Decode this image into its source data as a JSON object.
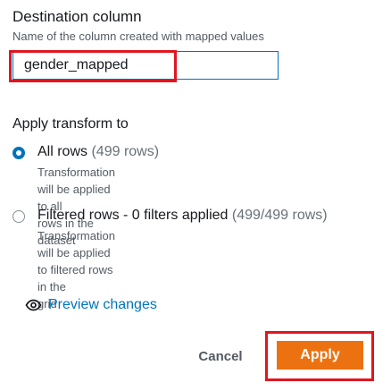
{
  "destination": {
    "title": "Destination column",
    "subtitle": "Name of the column created with mapped values",
    "value": "gender_mapped"
  },
  "transform": {
    "title": "Apply transform to",
    "options": [
      {
        "label": "All rows",
        "count": "(499 rows)",
        "description_line1": "Transformation will be applied to all",
        "description_line2": "rows in the dataset",
        "selected": true
      },
      {
        "label": "Filtered rows - 0 filters applied",
        "count": "(499/499 rows)",
        "description_line1": "Transformation will be applied to filtered rows in the",
        "description_line2": "grid",
        "selected": false
      }
    ]
  },
  "preview": {
    "label": "Preview changes",
    "icon": "eye-icon"
  },
  "actions": {
    "cancel_label": "Cancel",
    "apply_label": "Apply"
  },
  "colors": {
    "accent": "#0073bb",
    "primary_button": "#ec7211",
    "highlight_box": "#e0161f"
  }
}
